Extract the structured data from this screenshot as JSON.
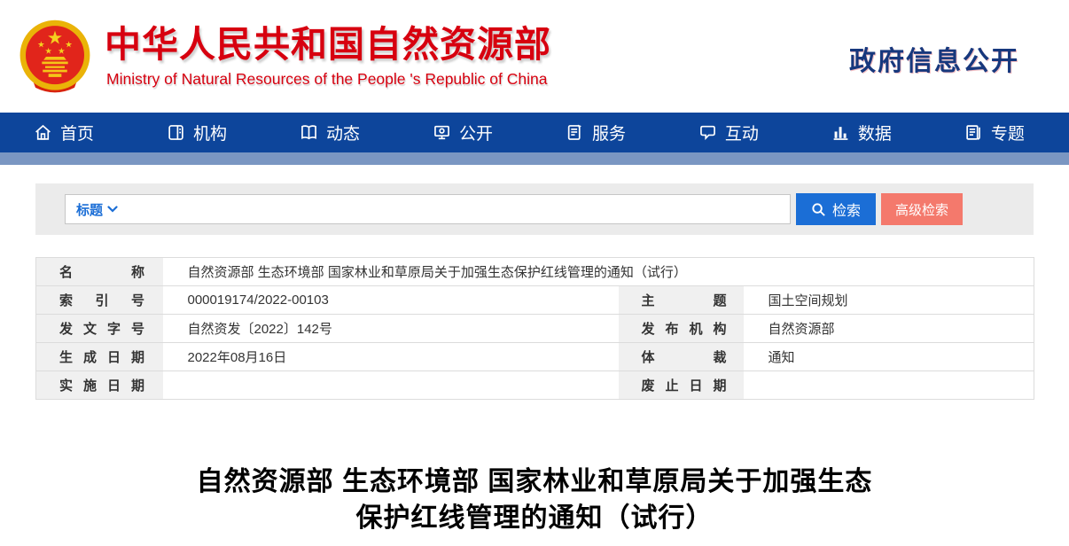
{
  "header": {
    "site_title": "中华人民共和国自然资源部",
    "site_subtitle": "Ministry of Natural Resources of the People 's Republic of China",
    "section_title": "政府信息公开"
  },
  "nav": {
    "items": [
      {
        "label": "首页",
        "icon": "home-icon"
      },
      {
        "label": "机构",
        "icon": "organization-icon"
      },
      {
        "label": "动态",
        "icon": "news-icon"
      },
      {
        "label": "公开",
        "icon": "disclosure-icon"
      },
      {
        "label": "服务",
        "icon": "service-icon"
      },
      {
        "label": "互动",
        "icon": "interaction-icon"
      },
      {
        "label": "数据",
        "icon": "data-icon"
      },
      {
        "label": "专题",
        "icon": "topic-icon"
      }
    ]
  },
  "search": {
    "field_label": "标题",
    "input_value": "",
    "input_placeholder": "",
    "search_button_label": "检索",
    "advanced_button_label": "高级检索"
  },
  "meta_table": {
    "name_label": "名称",
    "name_value": "自然资源部 生态环境部 国家林业和草原局关于加强生态保护红线管理的通知（试行）",
    "rows": [
      {
        "label_left": "索引号",
        "value_left": "000019174/2022-00103",
        "label_right": "主题",
        "value_right": "国土空间规划"
      },
      {
        "label_left": "发文字号",
        "value_left": "自然资发〔2022〕142号",
        "label_right": "发布机构",
        "value_right": "自然资源部"
      },
      {
        "label_left": "生成日期",
        "value_left": "2022年08月16日",
        "label_right": "体裁",
        "value_right": "通知"
      },
      {
        "label_left": "实施日期",
        "value_left": "",
        "label_right": "废止日期",
        "value_right": ""
      }
    ]
  },
  "document": {
    "title_line1": "自然资源部 生态环境部 国家林业和草原局关于加强生态",
    "title_line2": "保护红线管理的通知（试行）"
  },
  "colors": {
    "brand_red": "#d7000f",
    "navy_heading": "#17387d",
    "nav_blue": "#0d459b",
    "strip_blue": "#7a96c2",
    "search_button_blue": "#1b6ed6",
    "advanced_button_coral": "#f4796c"
  }
}
